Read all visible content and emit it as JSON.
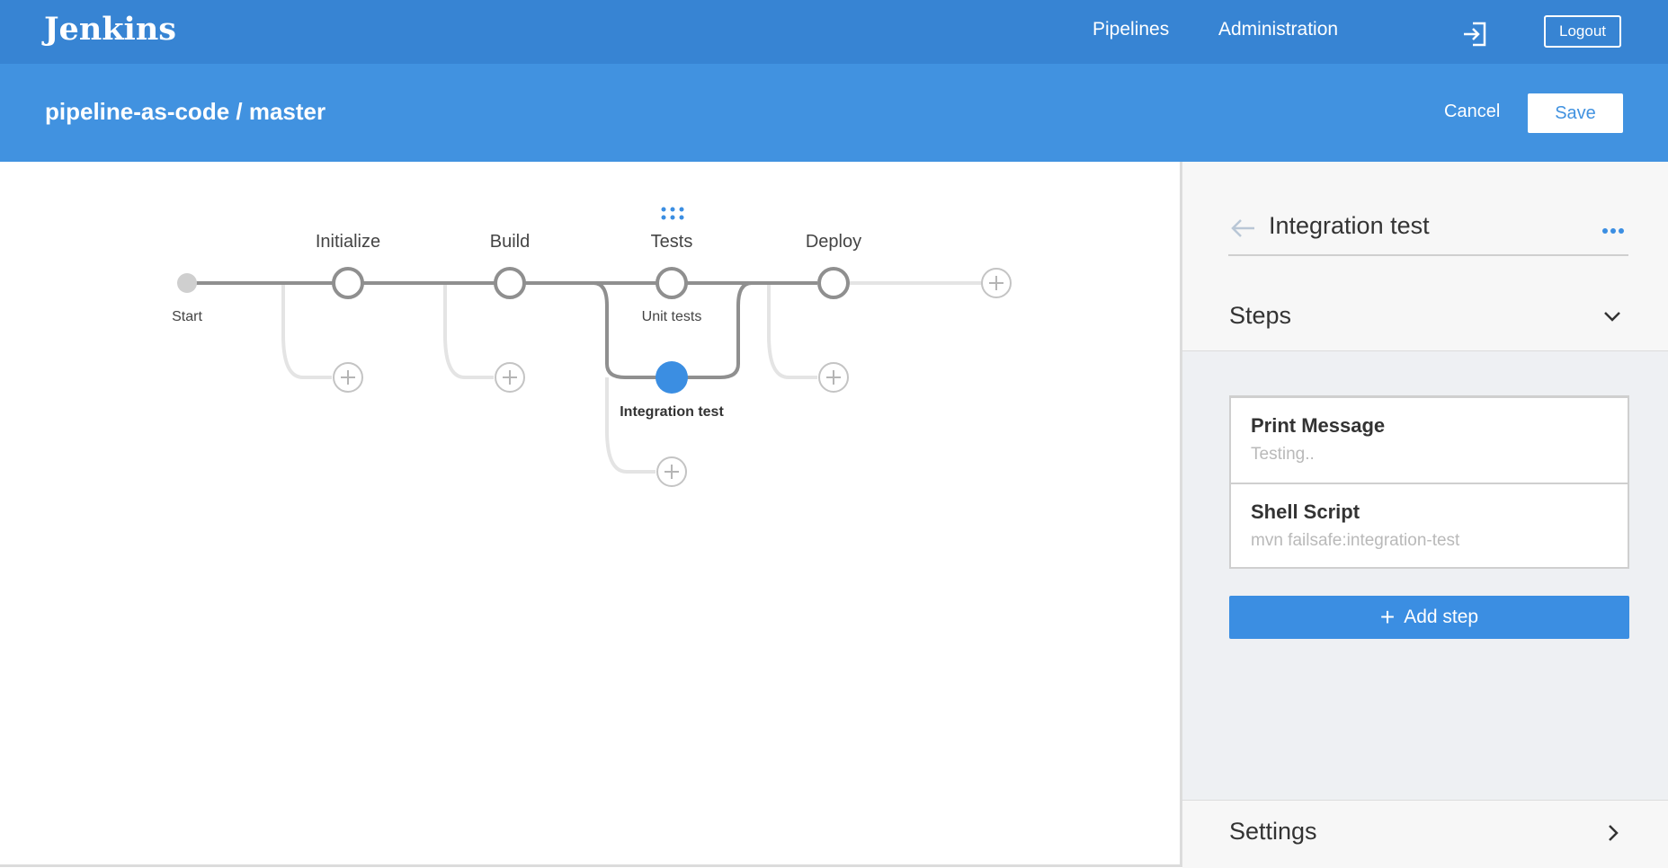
{
  "topbar": {
    "logo": "Jenkins",
    "nav": [
      "Pipelines",
      "Administration"
    ],
    "exit_icon": "exit-icon",
    "logout_label": "Logout",
    "color": "#3784d3"
  },
  "subbar": {
    "title": "pipeline-as-code / master",
    "cancel_label": "Cancel",
    "save_label": "Save",
    "color": "#4192e0"
  },
  "pipeline": {
    "start_label": "Start",
    "stages": [
      "Initialize",
      "Build",
      "Tests",
      "Deploy"
    ],
    "parallel_branches": [
      "Unit tests",
      "Integration test"
    ],
    "selected_node": "Integration test",
    "accent": "#4192e0"
  },
  "panel": {
    "title": "Integration test",
    "steps_label": "Steps",
    "steps": [
      {
        "title": "Print Message",
        "subtitle": "Testing.."
      },
      {
        "title": "Shell Script",
        "subtitle": "mvn failsafe:integration-test"
      }
    ],
    "add_step_label": "Add step",
    "settings_label": "Settings"
  }
}
